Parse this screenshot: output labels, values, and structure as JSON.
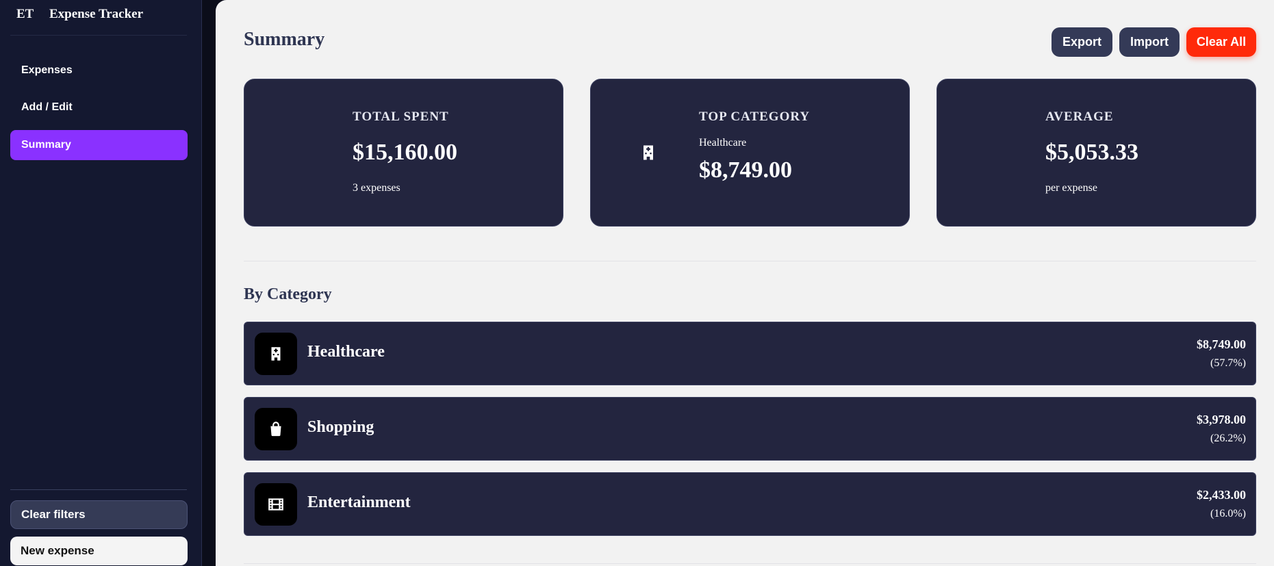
{
  "app": {
    "logo": "ET",
    "title": "Expense Tracker"
  },
  "sidebar": {
    "items": [
      {
        "label": "Expenses",
        "active": false
      },
      {
        "label": "Add / Edit",
        "active": false
      },
      {
        "label": "Summary",
        "active": true
      }
    ],
    "clear_filters_label": "Clear filters",
    "new_expense_label": "New expense"
  },
  "header": {
    "title": "Summary",
    "export_label": "Export",
    "import_label": "Import",
    "clear_all_label": "Clear All"
  },
  "cards": {
    "total": {
      "label": "TOTAL SPENT",
      "value": "$15,160.00",
      "sub": "3 expenses"
    },
    "top": {
      "label": "TOP CATEGORY",
      "category": "Healthcare",
      "value": "$8,749.00",
      "icon": "hospital-icon"
    },
    "average": {
      "label": "AVERAGE",
      "value": "$5,053.33",
      "sub": "per expense"
    }
  },
  "by_category": {
    "title": "By Category",
    "rows": [
      {
        "name": "Healthcare",
        "amount": "$8,749.00",
        "percent": "(57.7%)",
        "icon": "hospital-icon"
      },
      {
        "name": "Shopping",
        "amount": "$3,978.00",
        "percent": "(26.2%)",
        "icon": "shopping-bag-icon"
      },
      {
        "name": "Entertainment",
        "amount": "$2,433.00",
        "percent": "(16.0%)",
        "icon": "film-icon"
      }
    ]
  },
  "colors": {
    "accent": "#8a31ff",
    "danger": "#ff2a0a",
    "card_bg": "#23253f",
    "sidebar_bg": "#141830",
    "main_bg": "#f2f2f2"
  }
}
